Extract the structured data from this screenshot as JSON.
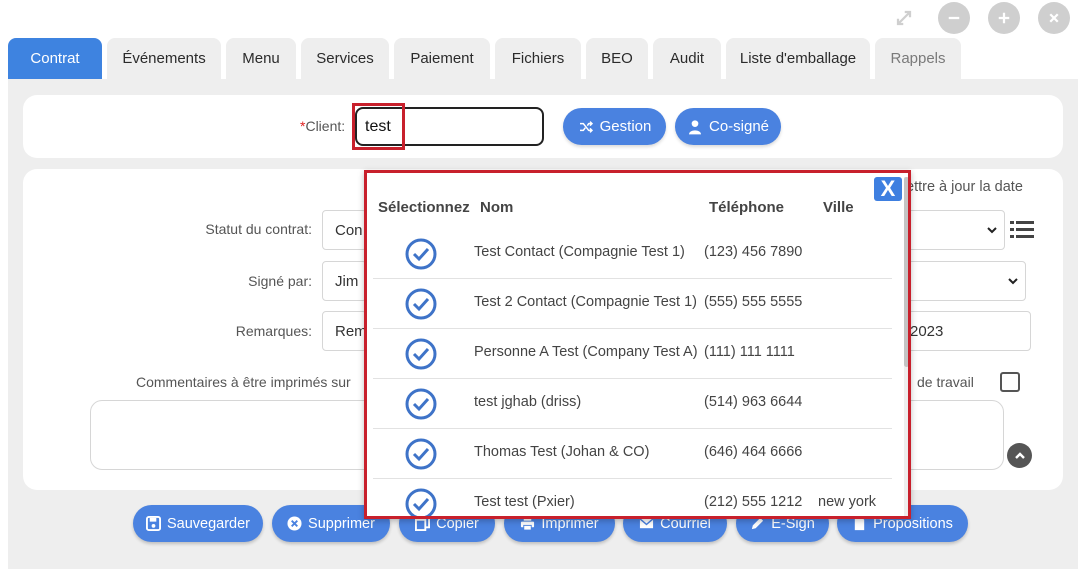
{
  "window_controls": [
    "expand-icon",
    "minus-icon",
    "plus-icon",
    "close-icon"
  ],
  "tabs": [
    {
      "label": "Contrat",
      "active": true
    },
    {
      "label": "Événements"
    },
    {
      "label": "Menu"
    },
    {
      "label": "Services"
    },
    {
      "label": "Paiement"
    },
    {
      "label": "Fichiers"
    },
    {
      "label": "BEO"
    },
    {
      "label": "Audit"
    },
    {
      "label": "Liste d'emballage"
    },
    {
      "label": "Rappels",
      "disabled": true
    }
  ],
  "client": {
    "required_mark": "*",
    "label": "Client:",
    "value": "test",
    "gestion_label": "Gestion",
    "cosigne_label": "Co-signé"
  },
  "form": {
    "update_date_text": "ettre à jour la date",
    "statut_label": "Statut du contrat:",
    "statut_value": "Con",
    "signe_label": "Signé par:",
    "signe_value": "Jim",
    "remarques_label": "Remarques:",
    "remarques_value": "Rem",
    "date_value": "2023",
    "commentaires_label": "Commentaires à être imprimés sur",
    "travail_label": "de travail"
  },
  "popup": {
    "close_label": "X",
    "headers": {
      "select": "Sélectionnez",
      "name": "Nom",
      "phone": "Téléphone",
      "city": "Ville"
    },
    "rows": [
      {
        "name": "Test Contact (Compagnie Test 1)",
        "phone": "(123) 456 7890",
        "city": ""
      },
      {
        "name": "Test 2 Contact (Compagnie Test 1)",
        "phone": "(555) 555 5555",
        "city": ""
      },
      {
        "name": "Personne A Test (Company Test A)",
        "phone": "(111) 111 1111",
        "city": ""
      },
      {
        "name": "test jghab (driss)",
        "phone": "(514) 963 6644",
        "city": ""
      },
      {
        "name": "Thomas Test (Johan & CO)",
        "phone": "(646) 464 6666",
        "city": ""
      },
      {
        "name": "Test test (Pxier)",
        "phone": "(212) 555 1212",
        "city": "new york"
      }
    ]
  },
  "actions": {
    "save": "Sauvegarder",
    "delete": "Supprimer",
    "copy": "Copier",
    "print": "Imprimer",
    "mail": "Courriel",
    "esign": "E-Sign",
    "proposals": "Propositions"
  },
  "colors": {
    "accent": "#3e83e0",
    "highlight": "#c8202c",
    "panel_bg": "#eeeeee"
  }
}
